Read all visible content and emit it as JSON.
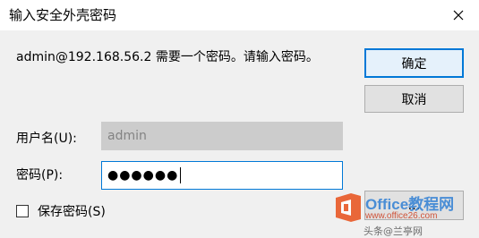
{
  "window": {
    "title": "输入安全外壳密码",
    "close_icon": "close-icon"
  },
  "message": "admin@192.168.56.2 需要一个密码。请输入密码。",
  "buttons": {
    "ok": "确定",
    "cancel": "取消",
    "details": "…"
  },
  "form": {
    "username_label": "用户名(U):",
    "username_value": "admin",
    "password_label": "密码(P):",
    "password_mask": "●●●●●●",
    "save_password_label": "保存密码(S)",
    "save_password_checked": false
  },
  "watermark": {
    "brand": "Office教程网",
    "url": "www.office26.com",
    "footer": "头条@兰亭网"
  },
  "colors": {
    "accent": "#0078d7",
    "dialog_bg": "#f0f0f0",
    "disabled_field": "#cccccc",
    "watermark_orange": "#e8501a",
    "watermark_blue": "#2f7fd4"
  }
}
